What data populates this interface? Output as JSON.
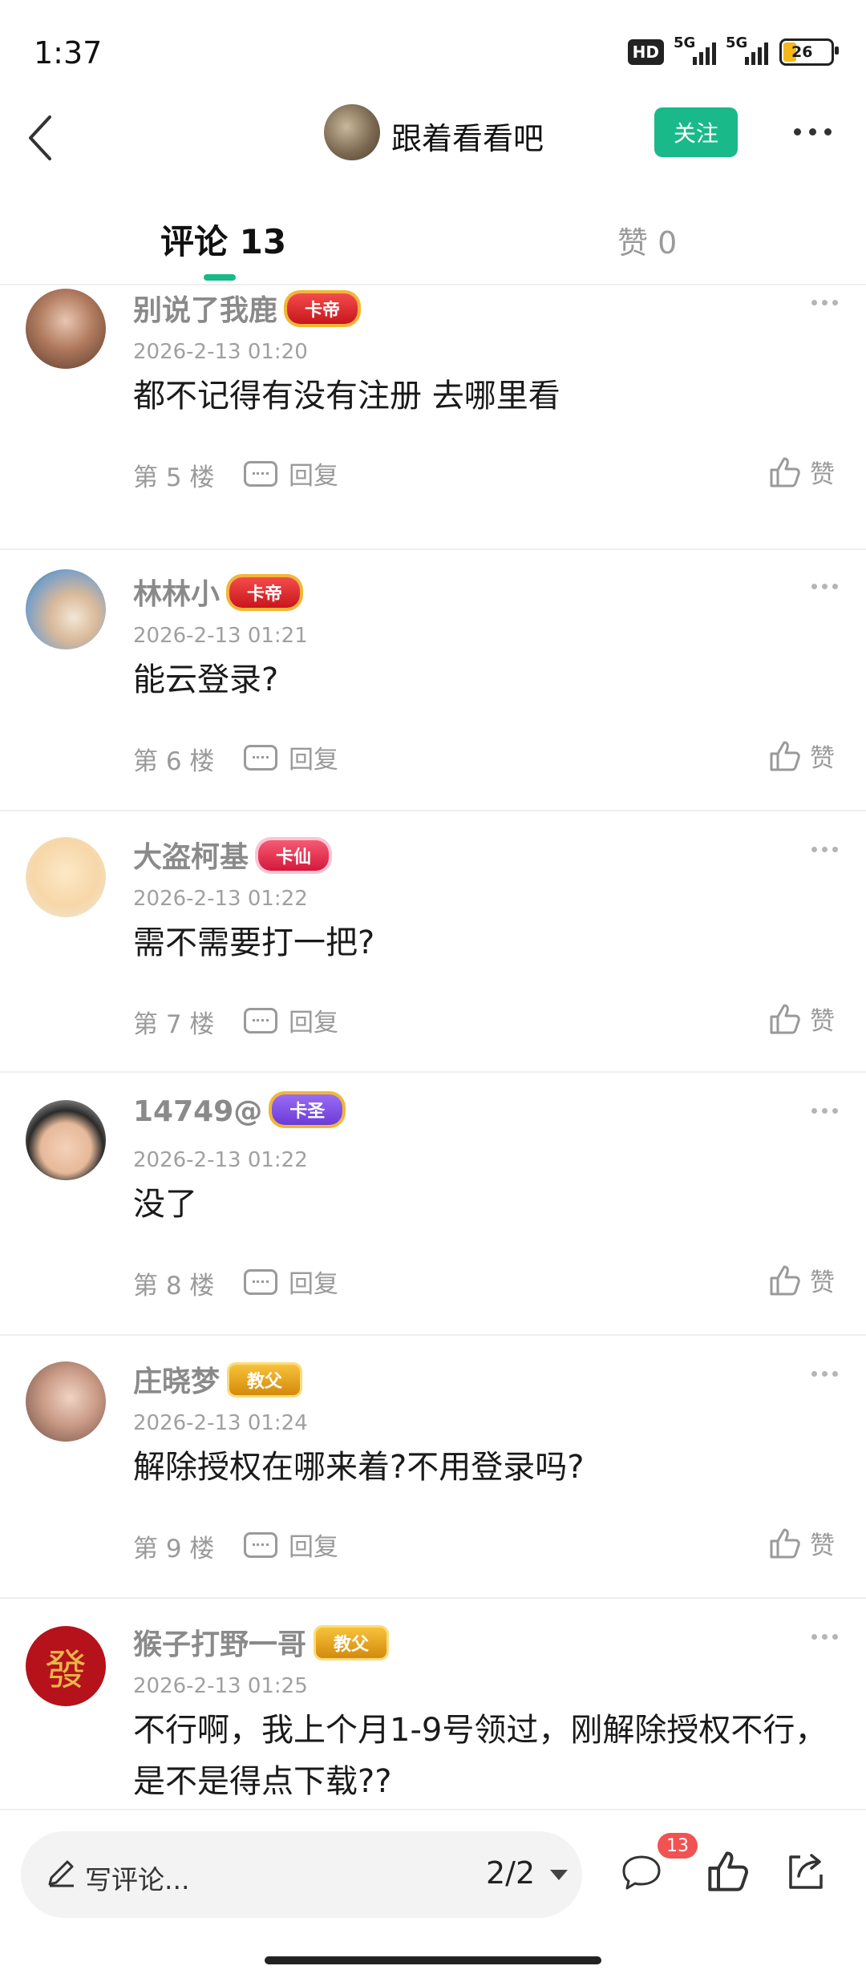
{
  "status_bar": {
    "time": "1:37",
    "network1": "5G",
    "network2": "5G",
    "hd_label": "HD",
    "battery": "26"
  },
  "header": {
    "title": "跟着看看吧",
    "follow_label": "关注"
  },
  "tabs": {
    "comments": "评论 13",
    "likes": "赞 0"
  },
  "comments": [
    {
      "name": "别说了我鹿",
      "badge": "卡帝",
      "time": "2026-2-13 01:20",
      "text": "都不记得有没有注册 去哪里看",
      "floor": "第 5 楼",
      "reply": "回复",
      "like": "赞"
    },
    {
      "name": "林林小",
      "badge": "卡帝",
      "time": "2026-2-13 01:21",
      "text": "能云登录?",
      "floor": "第 6 楼",
      "reply": "回复",
      "like": "赞"
    },
    {
      "name": "大盗柯基",
      "badge": "卡仙",
      "time": "2026-2-13 01:22",
      "text": "需不需要打一把?",
      "floor": "第 7 楼",
      "reply": "回复",
      "like": "赞"
    },
    {
      "name": "14749@",
      "badge": "卡圣",
      "time": "2026-2-13 01:22",
      "text": "没了",
      "floor": "第 8 楼",
      "reply": "回复",
      "like": "赞"
    },
    {
      "name": "庄晓梦",
      "badge": "教父",
      "time": "2026-2-13 01:24",
      "text": "解除授权在哪来着?不用登录吗?",
      "floor": "第 9 楼",
      "reply": "回复",
      "like": "赞"
    },
    {
      "name": "猴子打野一哥",
      "badge": "教父",
      "time": "2026-2-13 01:25",
      "text": "不行啊，我上个月1-9号领过，刚解除授权不行，是不是得点下载??",
      "avatar_char": "發"
    }
  ],
  "bottom_bar": {
    "placeholder": "写评论...",
    "page": "2/2",
    "comment_count": "13"
  },
  "colors": {
    "accent": "#19b98a",
    "badge_red": "#f15252"
  }
}
